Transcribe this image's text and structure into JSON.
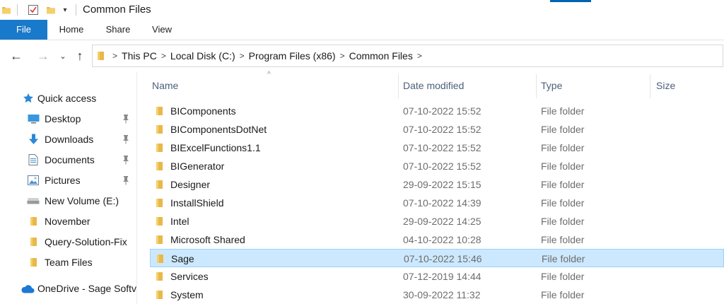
{
  "window": {
    "title": "Common Files"
  },
  "quick_access_toolbar": {
    "caret_glyph": "▾"
  },
  "ribbon": {
    "tabs": [
      {
        "label": "File"
      },
      {
        "label": "Home"
      },
      {
        "label": "Share"
      },
      {
        "label": "View"
      }
    ]
  },
  "navigation": {
    "back_glyph": "←",
    "forward_glyph": "→",
    "recent_glyph": "⌄",
    "up_glyph": "↑",
    "breadcrumbs": [
      "This PC",
      "Local Disk (C:)",
      "Program Files (x86)",
      "Common Files"
    ],
    "separator": ">"
  },
  "sidebar": {
    "quick_access": "Quick access",
    "items": [
      {
        "label": "Desktop",
        "icon": "desktop-icon",
        "pinned": true
      },
      {
        "label": "Downloads",
        "icon": "downloads-icon",
        "pinned": true
      },
      {
        "label": "Documents",
        "icon": "documents-icon",
        "pinned": true
      },
      {
        "label": "Pictures",
        "icon": "pictures-icon",
        "pinned": true
      },
      {
        "label": "New Volume (E:)",
        "icon": "drive-icon",
        "pinned": false
      },
      {
        "label": "November",
        "icon": "folder-icon",
        "pinned": false
      },
      {
        "label": "Query-Solution-Fix",
        "icon": "folder-icon",
        "pinned": false
      },
      {
        "label": "Team Files",
        "icon": "folder-icon",
        "pinned": false
      }
    ],
    "onedrive": "OneDrive - Sage Softv"
  },
  "columns": {
    "name": "Name",
    "date": "Date modified",
    "type": "Type",
    "size": "Size",
    "sort_glyph": "^"
  },
  "files": [
    {
      "name": "BIComponents",
      "date": "07-10-2022 15:52",
      "type": "File folder",
      "size": ""
    },
    {
      "name": "BIComponentsDotNet",
      "date": "07-10-2022 15:52",
      "type": "File folder",
      "size": ""
    },
    {
      "name": "BIExcelFunctions1.1",
      "date": "07-10-2022 15:52",
      "type": "File folder",
      "size": ""
    },
    {
      "name": "BIGenerator",
      "date": "07-10-2022 15:52",
      "type": "File folder",
      "size": ""
    },
    {
      "name": "Designer",
      "date": "29-09-2022 15:15",
      "type": "File folder",
      "size": ""
    },
    {
      "name": "InstallShield",
      "date": "07-10-2022 14:39",
      "type": "File folder",
      "size": ""
    },
    {
      "name": "Intel",
      "date": "29-09-2022 14:25",
      "type": "File folder",
      "size": ""
    },
    {
      "name": "Microsoft Shared",
      "date": "04-10-2022 10:28",
      "type": "File folder",
      "size": ""
    },
    {
      "name": "Sage",
      "date": "07-10-2022 15:46",
      "type": "File folder",
      "size": "",
      "selected": true
    },
    {
      "name": "Services",
      "date": "07-12-2019 14:44",
      "type": "File folder",
      "size": ""
    },
    {
      "name": "System",
      "date": "30-09-2022 11:32",
      "type": "File folder",
      "size": ""
    }
  ],
  "colors": {
    "accent": "#1979ca",
    "folder": "#e8b84a",
    "selection": "#cce8ff"
  }
}
